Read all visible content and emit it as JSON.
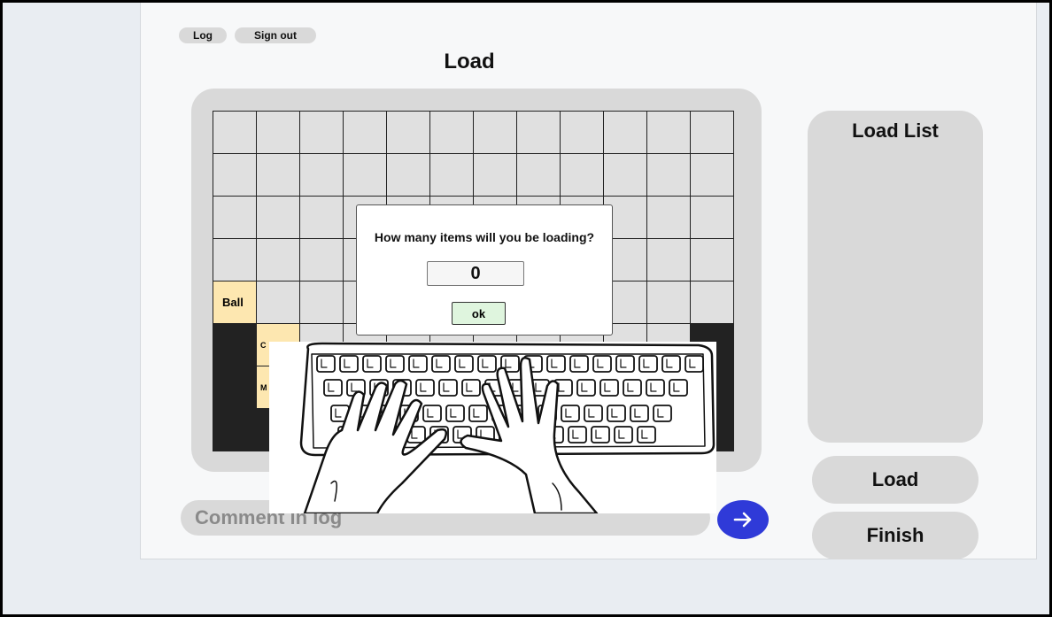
{
  "header": {
    "log_label": "Log",
    "signout_label": "Sign out",
    "title": "Load"
  },
  "grid": {
    "columns": 12,
    "rows": 8,
    "items": [
      {
        "row": 4,
        "col": 0,
        "label": "Ball"
      },
      {
        "row": 5,
        "col": 1,
        "label": "C"
      },
      {
        "row": 6,
        "col": 1,
        "label": "M"
      }
    ],
    "filled_cells": [
      [
        5,
        0
      ],
      [
        6,
        0
      ],
      [
        7,
        0
      ],
      [
        7,
        1
      ],
      [
        5,
        11
      ],
      [
        6,
        11
      ],
      [
        7,
        11
      ]
    ]
  },
  "modal": {
    "question": "How many items will you be loading?",
    "value": "0",
    "ok_label": "ok"
  },
  "comment": {
    "placeholder": "Comment in log"
  },
  "sidebar": {
    "load_list_title": "Load List",
    "load_label": "Load",
    "finish_label": "Finish"
  },
  "colors": {
    "accent": "#2f3ad8",
    "item_cell": "#fde7b0",
    "filled_cell": "#222222",
    "ok_button": "#dff5de"
  },
  "icons": {
    "send": "arrow-right-icon",
    "illustration": "keyboard-typing-hands"
  }
}
